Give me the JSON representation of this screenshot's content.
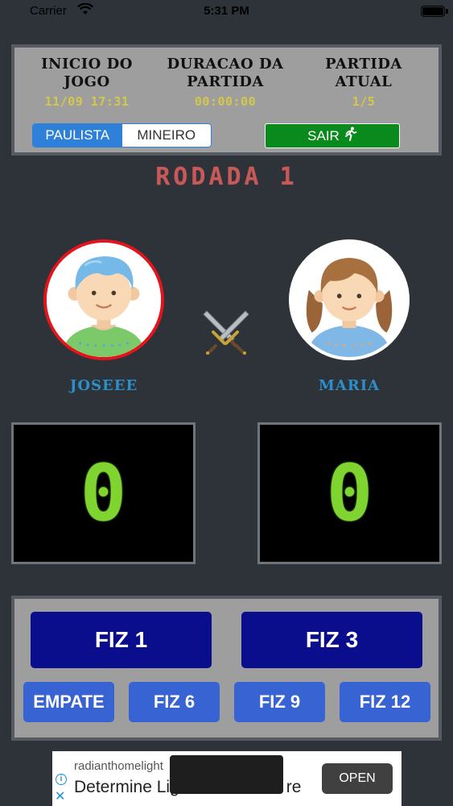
{
  "status_bar": {
    "carrier": "Carrier",
    "time": "5:31 PM"
  },
  "header": {
    "start_label": "INICIO DO\nJOGO",
    "start_label_line1": "INICIO DO",
    "start_label_line2": "JOGO",
    "start_value": "11/09 17:31",
    "duration_label_line1": "DURACAO DA",
    "duration_label_line2": "PARTIDA",
    "duration_value": "00:00:00",
    "match_label_line1": "PARTIDA",
    "match_label_line2": "ATUAL",
    "match_value": "1/5",
    "mode_options": [
      "PAULISTA",
      "MINEIRO"
    ],
    "mode_selected": "PAULISTA",
    "exit_label": "SAIR"
  },
  "round_title": "RODADA 1",
  "players": [
    {
      "name": "JOSEEE",
      "score": "0",
      "active": true
    },
    {
      "name": "MARIA",
      "score": "0",
      "active": false
    }
  ],
  "actions": {
    "big": [
      "FIZ 1",
      "FIZ 3"
    ],
    "small": [
      "EMPATE",
      "FIZ 6",
      "FIZ 9",
      "FIZ 12"
    ]
  },
  "ad": {
    "domain": "radianthomelight",
    "headline": "Determine Lig",
    "headline_tail": "re",
    "open_label": "OPEN"
  },
  "colors": {
    "active_player_border": "#e3141b",
    "score_digit": "#7fd430",
    "exit_button": "#0a8a1d",
    "primary_button": "#0b0e8c",
    "secondary_button": "#3864d3",
    "toggle_active": "#2f80d8"
  }
}
